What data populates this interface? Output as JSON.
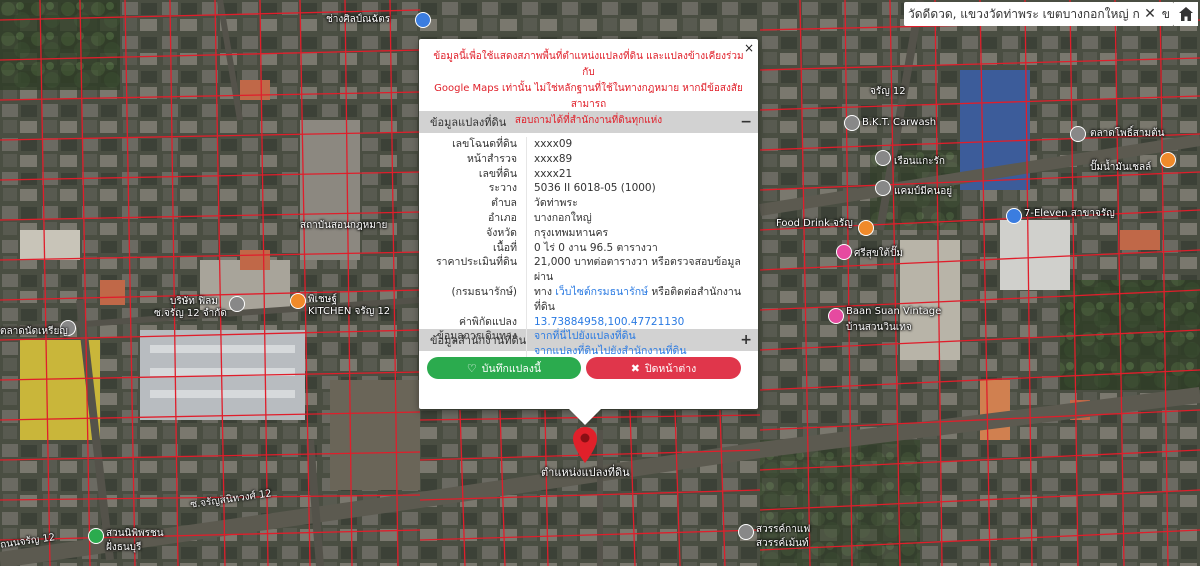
{
  "search": {
    "text": "วัดดีดวด, แขวงวัดท่าพระ เขตบางกอกใหญ่ กรุงเทพมหานคร",
    "clear": "✕",
    "more": "ข"
  },
  "popup": {
    "close": "×",
    "disclaimer_line1": "ข้อมูลนี้เพื่อใช้แสดงสภาพพื้นที่ตำแหน่งแปลงที่ดิน และแปลงข้างเคียงร่วมกับ",
    "disclaimer_line2": "Google Maps เท่านั้น ไม่ใช่หลักฐานที่ใช้ในทางกฎหมาย หากมีข้อสงสัยสามารถ",
    "disclaimer_line3": "สอบถามได้ที่สำนักงานที่ดินทุกแห่ง",
    "section1_title": "ข้อมูลแปลงที่ดิน",
    "section1_toggle": "−",
    "rows": [
      {
        "label": "เลขโฉนดที่ดิน",
        "value": "xxxx09"
      },
      {
        "label": "หน้าสำรวจ",
        "value": "xxxx89"
      },
      {
        "label": "เลขที่ดิน",
        "value": "xxxx21"
      },
      {
        "label": "ระวาง",
        "value": "5036 II 6018-05 (1000)"
      },
      {
        "label": "ตำบล",
        "value": "วัดท่าพระ"
      },
      {
        "label": "อำเภอ",
        "value": "บางกอกใหญ่"
      },
      {
        "label": "จังหวัด",
        "value": "กรุงเทพมหานคร"
      },
      {
        "label": "เนื้อที่",
        "value": "0 ไร่ 0 งาน 96.5 ตารางวา"
      },
      {
        "label": "ราคาประเมินที่ดิน",
        "value": "21,000 บาทต่อตารางวา หรือตรวจสอบข้อมูลผ่าน"
      },
      {
        "label": "(กรมธนารักษ์)",
        "value_prefix": "ทาง ",
        "value_link": "เว็บไซต์กรมธนารักษ์",
        "value_suffix": " หรือติดต่อสำนักงานที่ดิน"
      },
      {
        "label": "ค่าพิกัดแปลง",
        "value_link": "13.73884958,100.47721130"
      },
      {
        "label": "ข้อมูลการเดินทาง",
        "value_link": "จากที่นี่ไปยังแปลงที่ดิน"
      },
      {
        "label": "",
        "value_link": "จากแปลงที่ดินไปยังสำนักงานที่ดิน"
      }
    ],
    "section2_title": "ข้อมูลสำนักงานที่ดิน",
    "section2_toggle": "+",
    "save_label": "บันทึกแปลงนี้",
    "close_label": "ปิดหน้าต่าง"
  },
  "pin_label": "ตำแหน่งแปลงที่ดิน",
  "map_labels": {
    "l1": "ช่างศิลป์ณฉัตร",
    "l2": "จรัญ 12",
    "l3": "B.K.T. Carwash",
    "l4": "เรือนแกะรัก",
    "l5": "แคมป์มีคนอยู่",
    "l6": "7-Eleven สาขาจรัญ",
    "l7": "Food Drink จรัญ",
    "l8": "ศรีสุขใต้ปั๊ม",
    "l9": "Baan Suan Vintage",
    "l10": "บ้านสวนวินเทจ",
    "l11": "บริษัท ฟิลม",
    "l12": "ซ.จรัญ 12 จำกัด",
    "l13": "พิเชษฐ์",
    "l14": "KITCHEN จรัญ 12",
    "l15": "ตลาดนัดเหรียญ",
    "l16": "ลานจอดรถ",
    "l17": "สวนนิพิพรชน",
    "l18": "ฝั่งธนบุรี",
    "l19": "สถาบันสอนกฎหมาย",
    "l20": "ซ.จรัญสนิทวงศ์ 12",
    "l21": "ซ.จรัญสนิทวงศ์ 12 แยก 4",
    "l22": "ถนนจรัญ 12",
    "l23": "ซอย จรัญสนิทวงศ์ 12",
    "l24": "สวรรค์กาแฟ",
    "l25": "สวรรค์เม้นท์",
    "l26": "ตลาดโพธิ์สามต้น",
    "l27": "ปั๊มน้ำมันเชลล์"
  },
  "colors": {
    "parcel_line": "#e01e2b",
    "pin": "#e0202a",
    "save": "#2bab4e",
    "close": "#e0364b",
    "link": "#2a7ae2",
    "disclaimer": "#e0202a"
  }
}
